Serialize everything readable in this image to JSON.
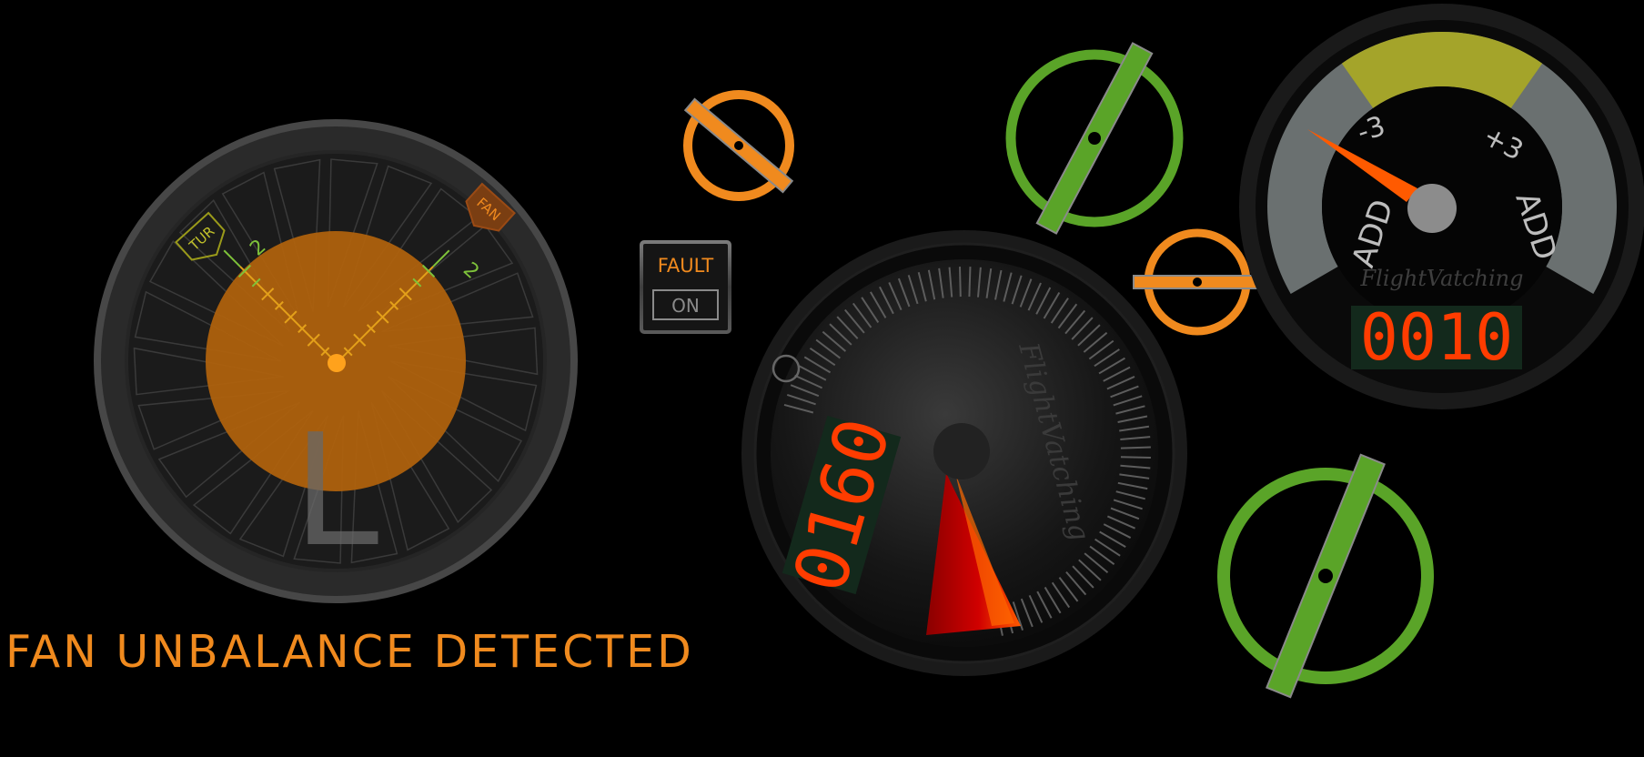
{
  "engine_fan": {
    "left_marker": "TUR",
    "right_marker": "FAN",
    "left_scale_value": "2",
    "right_scale_value": "2",
    "engine_side_letter": "L"
  },
  "warning": {
    "message": "FAN UNBALANCE DETECTED"
  },
  "fault_button": {
    "fault_label": "FAULT",
    "on_label": "ON"
  },
  "rotary_gauge": {
    "counter": "0160",
    "brand": "FlightVatching"
  },
  "trim_gauge": {
    "minus_label": "-3",
    "plus_label": "+3",
    "left_label": "ADD",
    "right_label": "ADD",
    "brand": "FlightVatching",
    "counter": "0010"
  },
  "colors": {
    "orange": "#f08a1e",
    "green": "#5aa428",
    "display_red": "#ff3c00",
    "band_yellow": "#a4a42a"
  },
  "icons": [
    "fan-blade-icon",
    "ring-handle-icon",
    "needle-icon"
  ]
}
